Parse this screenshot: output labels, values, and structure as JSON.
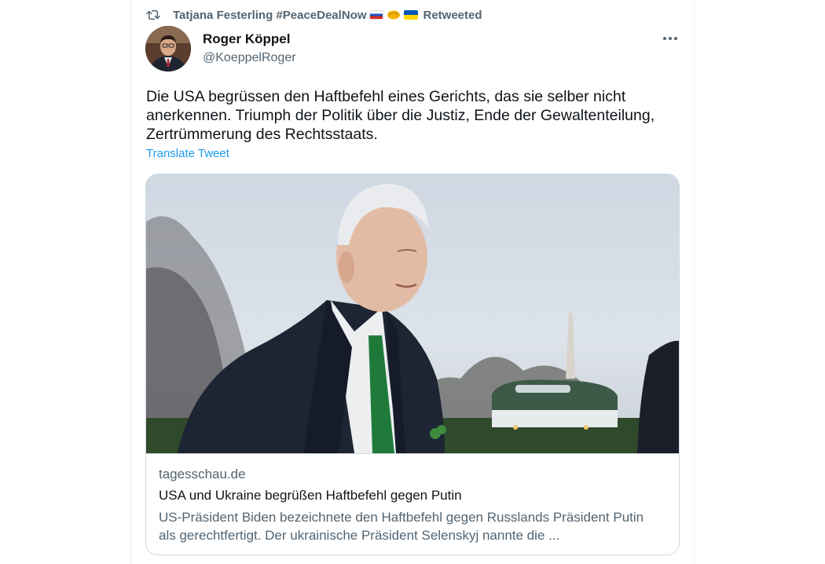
{
  "retweet": {
    "icon": "retweet-icon",
    "user": "Tatjana Festerling #PeaceDealNow",
    "emojis": [
      "russia-flag-icon",
      "handshake-icon",
      "ukraine-flag-icon"
    ],
    "suffix": "Retweeted"
  },
  "author": {
    "name": "Roger Köppel",
    "handle": "@KoeppelRoger"
  },
  "tweet": {
    "text": "Die USA begrüssen den Haftbefehl eines Gerichts, das sie selber nicht anerkennen. Triumph der Politik über die Justiz, Ende der Gewaltenteilung, Zertrümmerung des Rechtsstaats.",
    "translate_label": "Translate Tweet"
  },
  "card": {
    "domain": "tagesschau.de",
    "title": "USA und Ukraine begrüßen Haftbefehl gegen Putin",
    "description": "US-Präsident Biden bezeichnete den Haftbefehl gegen Russlands Präsident Putin als gerechtfertigt. Der ukrainische Präsident Selenskyj nannte die ..."
  },
  "colors": {
    "text_primary": "#0f1419",
    "text_secondary": "#536471",
    "link": "#1d9bf0",
    "border": "#cfd9de"
  }
}
